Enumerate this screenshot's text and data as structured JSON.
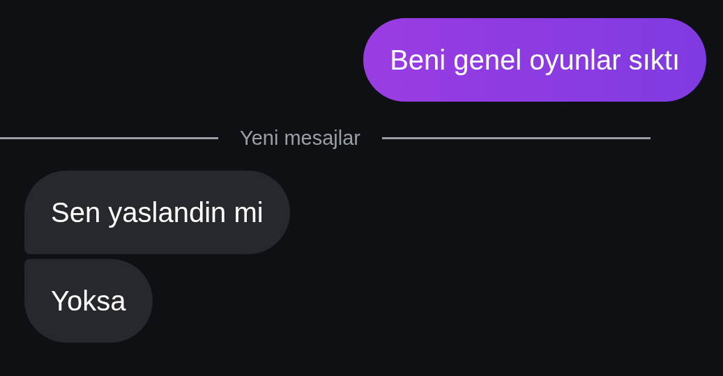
{
  "messages": [
    {
      "kind": "outgoing",
      "text": "Beni genel oyunlar sıktı"
    },
    {
      "kind": "divider",
      "text": "Yeni mesajlar"
    },
    {
      "kind": "incoming",
      "text": "Sen yaslandin mi"
    },
    {
      "kind": "incoming",
      "text": "Yoksa"
    }
  ]
}
